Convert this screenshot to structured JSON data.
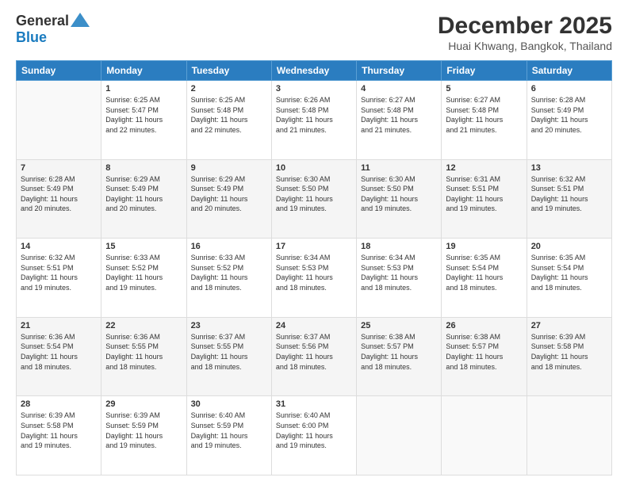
{
  "logo": {
    "general": "General",
    "blue": "Blue"
  },
  "title": "December 2025",
  "subtitle": "Huai Khwang, Bangkok, Thailand",
  "headers": [
    "Sunday",
    "Monday",
    "Tuesday",
    "Wednesday",
    "Thursday",
    "Friday",
    "Saturday"
  ],
  "weeks": [
    [
      {
        "day": "",
        "content": ""
      },
      {
        "day": "1",
        "content": "Sunrise: 6:25 AM\nSunset: 5:47 PM\nDaylight: 11 hours\nand 22 minutes."
      },
      {
        "day": "2",
        "content": "Sunrise: 6:25 AM\nSunset: 5:48 PM\nDaylight: 11 hours\nand 22 minutes."
      },
      {
        "day": "3",
        "content": "Sunrise: 6:26 AM\nSunset: 5:48 PM\nDaylight: 11 hours\nand 21 minutes."
      },
      {
        "day": "4",
        "content": "Sunrise: 6:27 AM\nSunset: 5:48 PM\nDaylight: 11 hours\nand 21 minutes."
      },
      {
        "day": "5",
        "content": "Sunrise: 6:27 AM\nSunset: 5:48 PM\nDaylight: 11 hours\nand 21 minutes."
      },
      {
        "day": "6",
        "content": "Sunrise: 6:28 AM\nSunset: 5:49 PM\nDaylight: 11 hours\nand 20 minutes."
      }
    ],
    [
      {
        "day": "7",
        "content": "Sunrise: 6:28 AM\nSunset: 5:49 PM\nDaylight: 11 hours\nand 20 minutes."
      },
      {
        "day": "8",
        "content": "Sunrise: 6:29 AM\nSunset: 5:49 PM\nDaylight: 11 hours\nand 20 minutes."
      },
      {
        "day": "9",
        "content": "Sunrise: 6:29 AM\nSunset: 5:49 PM\nDaylight: 11 hours\nand 20 minutes."
      },
      {
        "day": "10",
        "content": "Sunrise: 6:30 AM\nSunset: 5:50 PM\nDaylight: 11 hours\nand 19 minutes."
      },
      {
        "day": "11",
        "content": "Sunrise: 6:30 AM\nSunset: 5:50 PM\nDaylight: 11 hours\nand 19 minutes."
      },
      {
        "day": "12",
        "content": "Sunrise: 6:31 AM\nSunset: 5:51 PM\nDaylight: 11 hours\nand 19 minutes."
      },
      {
        "day": "13",
        "content": "Sunrise: 6:32 AM\nSunset: 5:51 PM\nDaylight: 11 hours\nand 19 minutes."
      }
    ],
    [
      {
        "day": "14",
        "content": "Sunrise: 6:32 AM\nSunset: 5:51 PM\nDaylight: 11 hours\nand 19 minutes."
      },
      {
        "day": "15",
        "content": "Sunrise: 6:33 AM\nSunset: 5:52 PM\nDaylight: 11 hours\nand 19 minutes."
      },
      {
        "day": "16",
        "content": "Sunrise: 6:33 AM\nSunset: 5:52 PM\nDaylight: 11 hours\nand 18 minutes."
      },
      {
        "day": "17",
        "content": "Sunrise: 6:34 AM\nSunset: 5:53 PM\nDaylight: 11 hours\nand 18 minutes."
      },
      {
        "day": "18",
        "content": "Sunrise: 6:34 AM\nSunset: 5:53 PM\nDaylight: 11 hours\nand 18 minutes."
      },
      {
        "day": "19",
        "content": "Sunrise: 6:35 AM\nSunset: 5:54 PM\nDaylight: 11 hours\nand 18 minutes."
      },
      {
        "day": "20",
        "content": "Sunrise: 6:35 AM\nSunset: 5:54 PM\nDaylight: 11 hours\nand 18 minutes."
      }
    ],
    [
      {
        "day": "21",
        "content": "Sunrise: 6:36 AM\nSunset: 5:54 PM\nDaylight: 11 hours\nand 18 minutes."
      },
      {
        "day": "22",
        "content": "Sunrise: 6:36 AM\nSunset: 5:55 PM\nDaylight: 11 hours\nand 18 minutes."
      },
      {
        "day": "23",
        "content": "Sunrise: 6:37 AM\nSunset: 5:55 PM\nDaylight: 11 hours\nand 18 minutes."
      },
      {
        "day": "24",
        "content": "Sunrise: 6:37 AM\nSunset: 5:56 PM\nDaylight: 11 hours\nand 18 minutes."
      },
      {
        "day": "25",
        "content": "Sunrise: 6:38 AM\nSunset: 5:57 PM\nDaylight: 11 hours\nand 18 minutes."
      },
      {
        "day": "26",
        "content": "Sunrise: 6:38 AM\nSunset: 5:57 PM\nDaylight: 11 hours\nand 18 minutes."
      },
      {
        "day": "27",
        "content": "Sunrise: 6:39 AM\nSunset: 5:58 PM\nDaylight: 11 hours\nand 18 minutes."
      }
    ],
    [
      {
        "day": "28",
        "content": "Sunrise: 6:39 AM\nSunset: 5:58 PM\nDaylight: 11 hours\nand 19 minutes."
      },
      {
        "day": "29",
        "content": "Sunrise: 6:39 AM\nSunset: 5:59 PM\nDaylight: 11 hours\nand 19 minutes."
      },
      {
        "day": "30",
        "content": "Sunrise: 6:40 AM\nSunset: 5:59 PM\nDaylight: 11 hours\nand 19 minutes."
      },
      {
        "day": "31",
        "content": "Sunrise: 6:40 AM\nSunset: 6:00 PM\nDaylight: 11 hours\nand 19 minutes."
      },
      {
        "day": "",
        "content": ""
      },
      {
        "day": "",
        "content": ""
      },
      {
        "day": "",
        "content": ""
      }
    ]
  ]
}
